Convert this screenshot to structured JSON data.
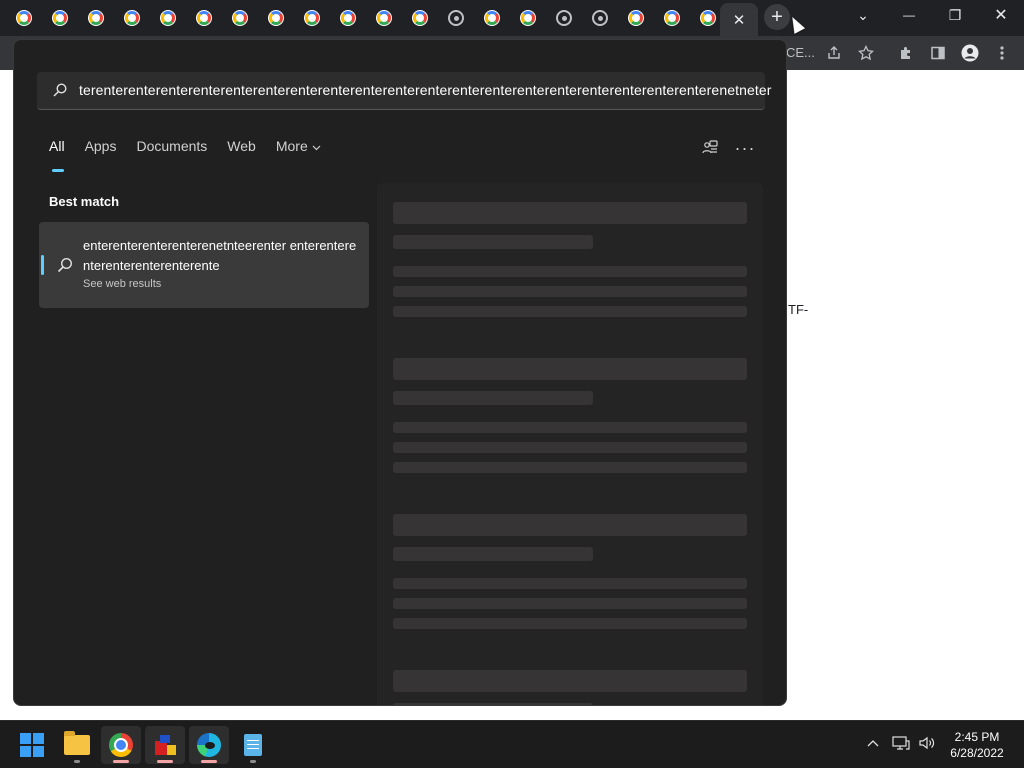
{
  "browser": {
    "active_tab_close": "✕",
    "new_tab": "+",
    "omnibox_fragment": "CE...",
    "page_fragment": "TF-",
    "window_controls": {
      "dropdown": "⌄",
      "minimize": "—",
      "restore": "❐",
      "close": "✕"
    },
    "toolbar_icons": [
      "share-icon",
      "star-icon",
      "extensions-icon",
      "side-panel-icon",
      "profile-icon",
      "menu-icon"
    ]
  },
  "search": {
    "query": "terenterenterenterenterenterenterenterenterenterenterenterenterenterenterenterenterenterenterenterenetneter",
    "filters": [
      {
        "label": "All",
        "active": true
      },
      {
        "label": "Apps",
        "active": false
      },
      {
        "label": "Documents",
        "active": false
      },
      {
        "label": "Web",
        "active": false
      },
      {
        "label": "More",
        "active": false
      }
    ],
    "best_match_heading": "Best match",
    "best_match": {
      "title": "enterenterenterenterenetnteerenter enterenterenterenterenterenterente",
      "subtitle": "See web results"
    },
    "header_icons": [
      "share-results-icon",
      "more-options-icon"
    ],
    "more_options_glyph": "···"
  },
  "taskbar": {
    "apps": [
      {
        "name": "start",
        "running": false
      },
      {
        "name": "file-explorer",
        "running": false
      },
      {
        "name": "chrome",
        "running": true
      },
      {
        "name": "archive-tool",
        "running": true
      },
      {
        "name": "edge",
        "running": true
      },
      {
        "name": "notepad",
        "running": false
      }
    ],
    "clock_time": "2:45 PM",
    "clock_date": "6/28/2022"
  },
  "colors": {
    "accent": "#60cdff",
    "panel_bg": "#202020",
    "taskbar_bg": "#1c1c1c",
    "chrome_frame": "#202124"
  }
}
